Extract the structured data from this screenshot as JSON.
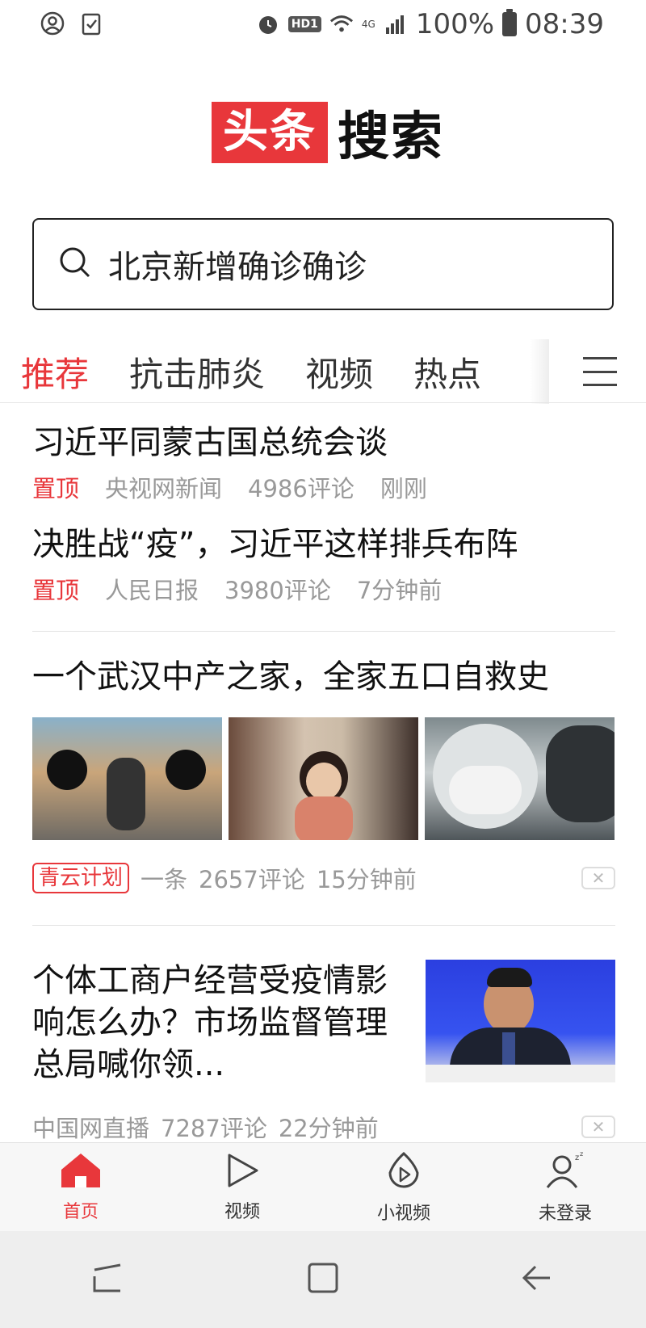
{
  "status_bar": {
    "battery": "100%",
    "time": "08:39",
    "hd_label": "HD1",
    "network_label": "4G"
  },
  "logo": {
    "red_text": "头条",
    "black_text": "搜索"
  },
  "search": {
    "query": "北京新增确诊确诊"
  },
  "tabs": [
    "推荐",
    "抗击肺炎",
    "视频",
    "热点"
  ],
  "feed": {
    "item1": {
      "title": "习近平同蒙古国总统会谈",
      "tag": "置顶",
      "source": "央视网新闻",
      "comments": "4986评论",
      "time": "刚刚"
    },
    "item2": {
      "title": "决胜战“疫”，习近平这样排兵布阵",
      "tag": "置顶",
      "source": "人民日报",
      "comments": "3980评论",
      "time": "7分钟前"
    },
    "item3": {
      "title": "一个武汉中产之家，全家五口自救史",
      "tag": "青云计划",
      "source": "一条",
      "comments": "2657评论",
      "time": "15分钟前"
    },
    "item4": {
      "title": "个体工商户经营受疫情影响怎么办？市场监督管理总局喊你领...",
      "source": "中国网直播",
      "comments": "7287评论",
      "time": "22分钟前"
    }
  },
  "bottom_nav": [
    {
      "label": "首页",
      "icon": "home-icon"
    },
    {
      "label": "视频",
      "icon": "play-icon"
    },
    {
      "label": "小视频",
      "icon": "small-video-icon"
    },
    {
      "label": "未登录",
      "icon": "user-icon"
    }
  ],
  "colors": {
    "accent": "#e8373b"
  }
}
